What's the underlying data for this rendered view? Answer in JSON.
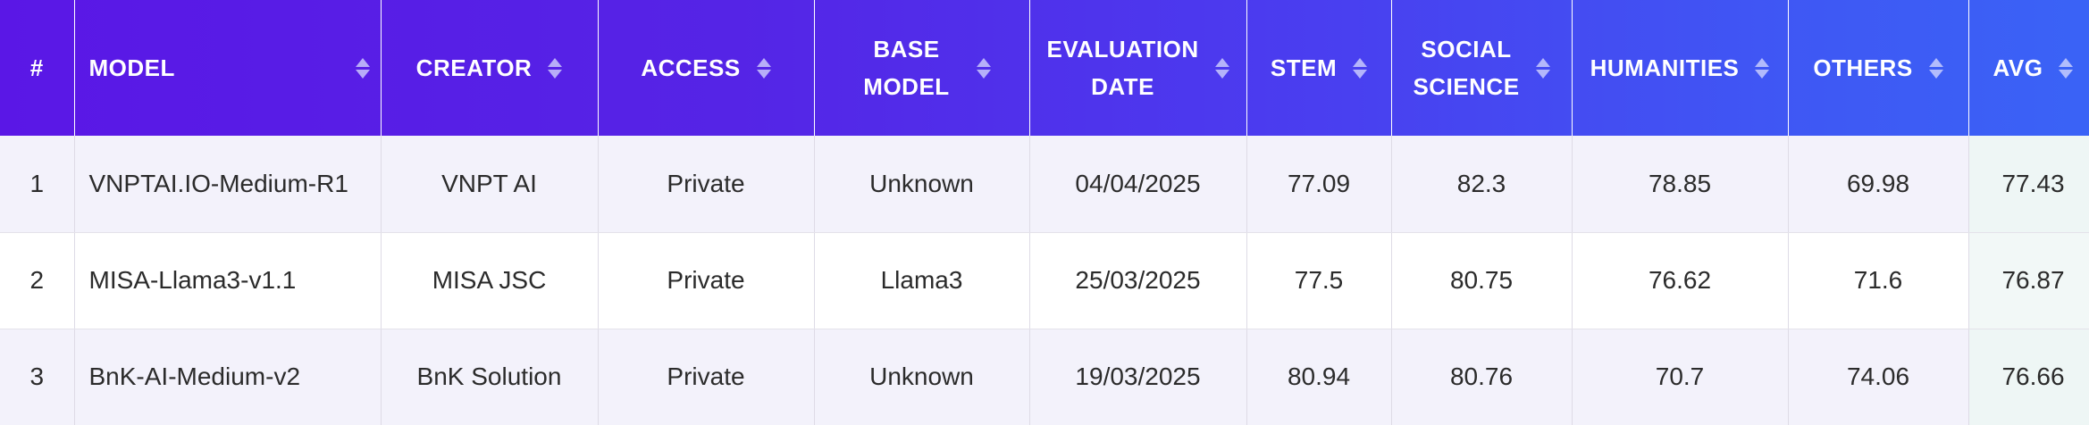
{
  "table": {
    "columns": [
      {
        "key": "rank",
        "label": "#",
        "sortable": false
      },
      {
        "key": "model",
        "label": "MODEL",
        "sortable": true
      },
      {
        "key": "creator",
        "label": "CREATOR",
        "sortable": true
      },
      {
        "key": "access",
        "label": "ACCESS",
        "sortable": true
      },
      {
        "key": "base_model",
        "label": "BASE MODEL",
        "sortable": true
      },
      {
        "key": "evaluation_date",
        "label": "EVALUATION DATE",
        "sortable": true
      },
      {
        "key": "stem",
        "label": "STEM",
        "sortable": true
      },
      {
        "key": "social_science",
        "label": "SOCIAL SCIENCE",
        "sortable": true
      },
      {
        "key": "humanities",
        "label": "HUMANITIES",
        "sortable": true
      },
      {
        "key": "others",
        "label": "OTHERS",
        "sortable": true
      },
      {
        "key": "avg",
        "label": "AVG",
        "sortable": true
      }
    ],
    "rows": [
      {
        "rank": "1",
        "model": "VNPTAI.IO-Medium-R1",
        "creator": "VNPT AI",
        "access": "Private",
        "base_model": "Unknown",
        "evaluation_date": "04/04/2025",
        "stem": "77.09",
        "social_science": "82.3",
        "humanities": "78.85",
        "others": "69.98",
        "avg": "77.43"
      },
      {
        "rank": "2",
        "model": "MISA-Llama3-v1.1",
        "creator": "MISA JSC",
        "access": "Private",
        "base_model": "Llama3",
        "evaluation_date": "25/03/2025",
        "stem": "77.5",
        "social_science": "80.75",
        "humanities": "76.62",
        "others": "71.6",
        "avg": "76.87"
      },
      {
        "rank": "3",
        "model": "BnK-AI-Medium-v2",
        "creator": "BnK Solution",
        "access": "Private",
        "base_model": "Unknown",
        "evaluation_date": "19/03/2025",
        "stem": "80.94",
        "social_science": "80.76",
        "humanities": "70.7",
        "others": "74.06",
        "avg": "76.66"
      }
    ]
  },
  "colors": {
    "header_gradient_start": "#5a17e6",
    "header_gradient_end": "#3a63f6",
    "avg_column_bg": "#eef6f5"
  },
  "icons": {
    "sort": "sort-icon"
  }
}
